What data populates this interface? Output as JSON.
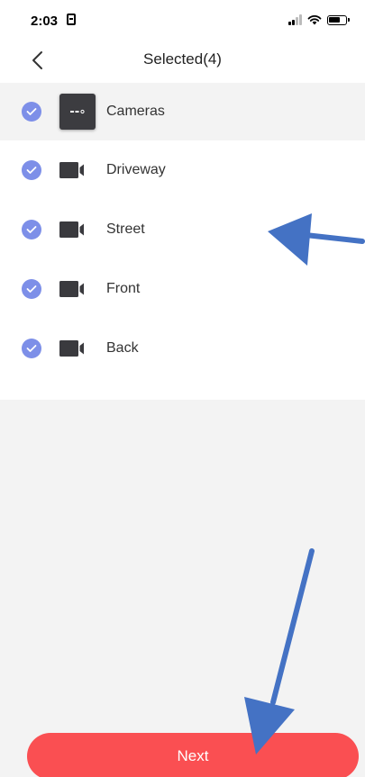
{
  "status_bar": {
    "time": "2:03",
    "icons": [
      "sim-card-icon",
      "signal-icon",
      "wifi-icon",
      "battery-icon"
    ]
  },
  "header": {
    "back_icon": "chevron-left-icon",
    "title": "Selected(4)"
  },
  "group": {
    "label": "Cameras",
    "icon": "nvr-recorder-icon",
    "checked": true
  },
  "channels": [
    {
      "label": "Driveway",
      "icon": "camera-icon",
      "checked": true
    },
    {
      "label": "Street",
      "icon": "camera-icon",
      "checked": true
    },
    {
      "label": "Front",
      "icon": "camera-icon",
      "checked": true
    },
    {
      "label": "Back",
      "icon": "camera-icon",
      "checked": true
    }
  ],
  "next_button": {
    "label": "Next"
  },
  "colors": {
    "check_accent": "#7d8fe8",
    "next_button": "#fa4f52",
    "annotation_arrow": "#4472c4",
    "background": "#f3f3f3"
  }
}
